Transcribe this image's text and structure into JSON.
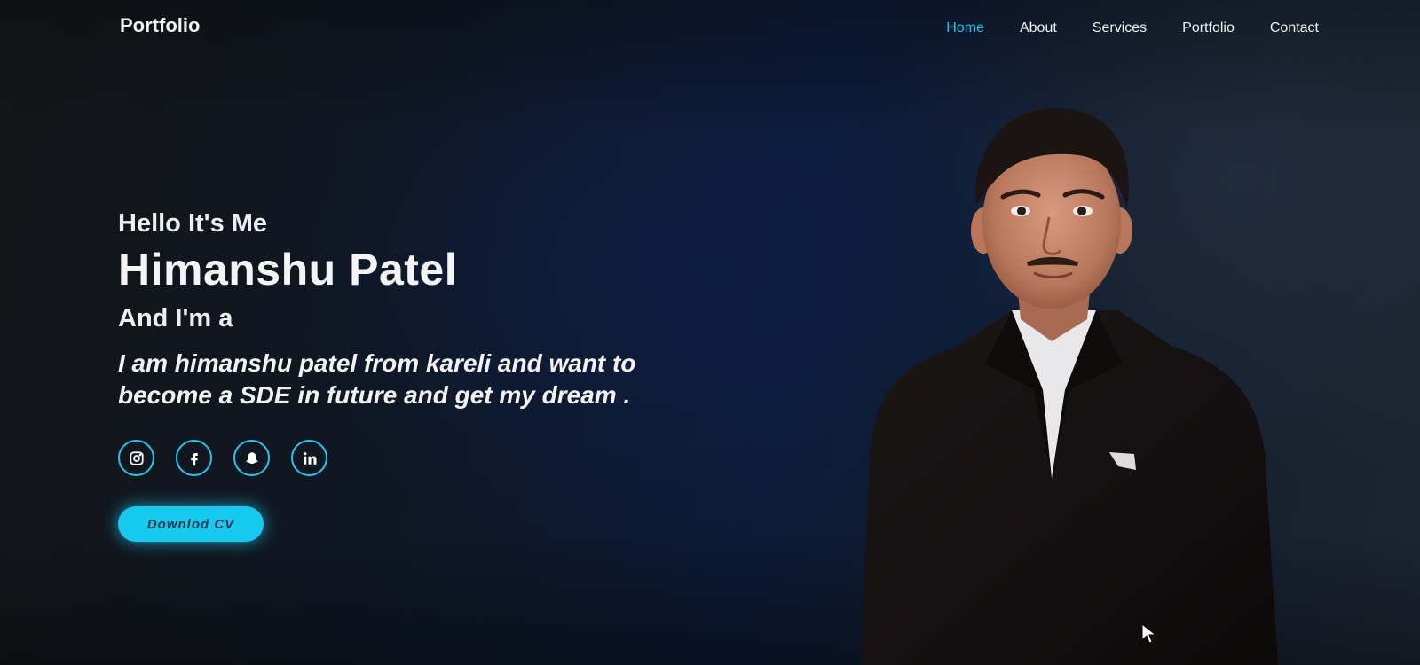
{
  "header": {
    "logo": "Portfolio",
    "nav": [
      {
        "label": "Home",
        "active": true
      },
      {
        "label": "About",
        "active": false
      },
      {
        "label": "Services",
        "active": false
      },
      {
        "label": "Portfolio",
        "active": false
      },
      {
        "label": "Contact",
        "active": false
      }
    ]
  },
  "hero": {
    "greeting": "Hello It's Me",
    "name": "Himanshu Patel",
    "role_prefix": "And I'm a",
    "description": "I am himanshu patel from kareli and want to become a SDE in future and get my dream .",
    "socials": [
      {
        "name": "instagram",
        "icon": "instagram-icon"
      },
      {
        "name": "facebook",
        "icon": "facebook-icon"
      },
      {
        "name": "snapchat",
        "icon": "snapchat-icon"
      },
      {
        "name": "linkedin",
        "icon": "linkedin-icon"
      }
    ],
    "cv_button": "Downlod CV"
  },
  "colors": {
    "accent": "#1ec8f0",
    "background": "#0d1420",
    "text": "#f2f2f2"
  }
}
